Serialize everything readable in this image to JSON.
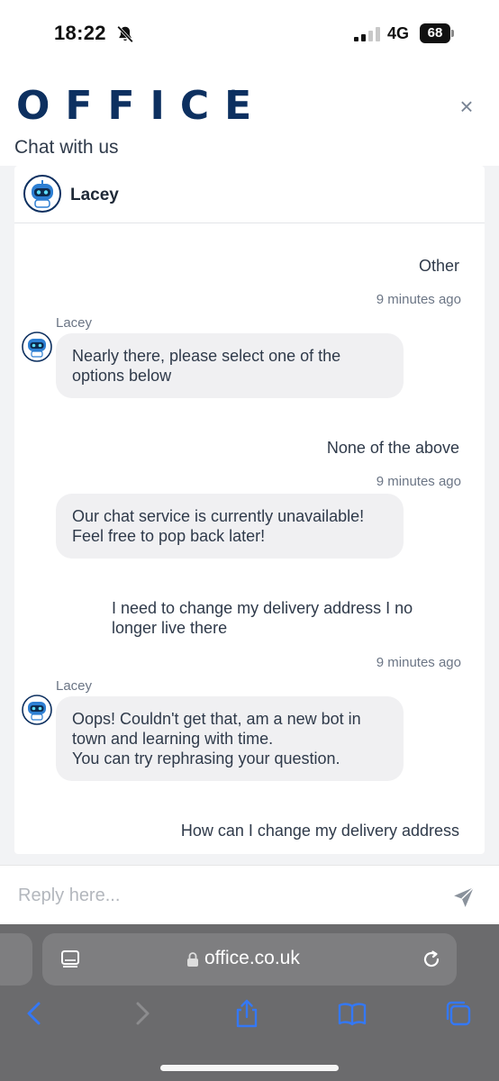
{
  "status_bar": {
    "time": "18:22",
    "network": "4G",
    "battery": "68"
  },
  "header": {
    "logo": "OFFICE",
    "logo_mark": "®",
    "close_label": "×",
    "title": "Chat with us"
  },
  "agent": {
    "name": "Lacey"
  },
  "messages": [
    {
      "from": "user",
      "text": "Other",
      "time": "9 minutes ago"
    },
    {
      "from": "bot",
      "sender": "Lacey",
      "text": "Nearly there, please select one of the options below"
    },
    {
      "from": "user",
      "text": "None of the above",
      "time": "9 minutes ago"
    },
    {
      "from": "bot",
      "text": "Our chat service is currently unavailable! Feel free to pop back later!"
    },
    {
      "from": "user",
      "text": "I need to change my delivery address I no longer live there",
      "time": "9 minutes ago"
    },
    {
      "from": "bot",
      "sender": "Lacey",
      "text_line1": "Oops! Couldn't get that, am a new bot in town and learning with time.",
      "text_line2": "You can try rephrasing your question."
    },
    {
      "from": "user",
      "text": "How can I change my delivery address"
    }
  ],
  "reply": {
    "placeholder": "Reply here..."
  },
  "browser": {
    "url": "office.co.uk"
  },
  "icons": {
    "bell": "bell-slash-icon",
    "signal": "signal-bars-icon",
    "send": "send-icon",
    "reader": "reader-mode-icon",
    "lock": "lock-icon",
    "reload": "reload-icon",
    "back": "chevron-left-icon",
    "forward": "chevron-right-icon",
    "share": "share-icon",
    "bookmarks": "book-icon",
    "tabs": "tabs-icon"
  },
  "colors": {
    "brand": "#0d3060",
    "ios_blue": "#3478f6",
    "bubble": "#f0f0f2",
    "browser_bar": "#6b6b6d"
  }
}
